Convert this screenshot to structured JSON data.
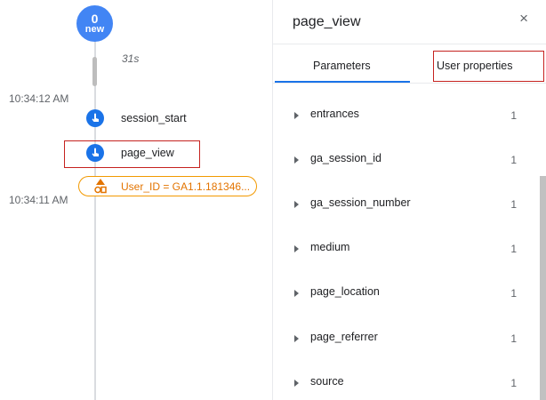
{
  "timeline": {
    "new_count": "0",
    "new_label": "new",
    "duration": "31s",
    "timestamps": [
      "10:34:12 AM",
      "10:34:11 AM"
    ],
    "events": [
      {
        "label": "session_start"
      },
      {
        "label": "page_view"
      }
    ],
    "user_id_label": "User_ID = GA1.1.181346..."
  },
  "panel": {
    "title": "page_view",
    "close_glyph": "×",
    "tabs": [
      {
        "label": "Parameters",
        "active": true
      },
      {
        "label": "User properties",
        "active": false
      }
    ],
    "parameters": [
      {
        "name": "entrances",
        "count": "1"
      },
      {
        "name": "ga_session_id",
        "count": "1"
      },
      {
        "name": "ga_session_number",
        "count": "1"
      },
      {
        "name": "medium",
        "count": "1"
      },
      {
        "name": "page_location",
        "count": "1"
      },
      {
        "name": "page_referrer",
        "count": "1"
      },
      {
        "name": "source",
        "count": "1"
      }
    ]
  },
  "colors": {
    "accent": "#1a73e8",
    "bubble": "#4285f4",
    "highlight": "#c5221f",
    "user_property": "#e37400"
  },
  "icons": {
    "event": "touch-icon",
    "user_property": "shapes-icon",
    "close": "close-icon",
    "expand": "expand-arrow-icon"
  }
}
